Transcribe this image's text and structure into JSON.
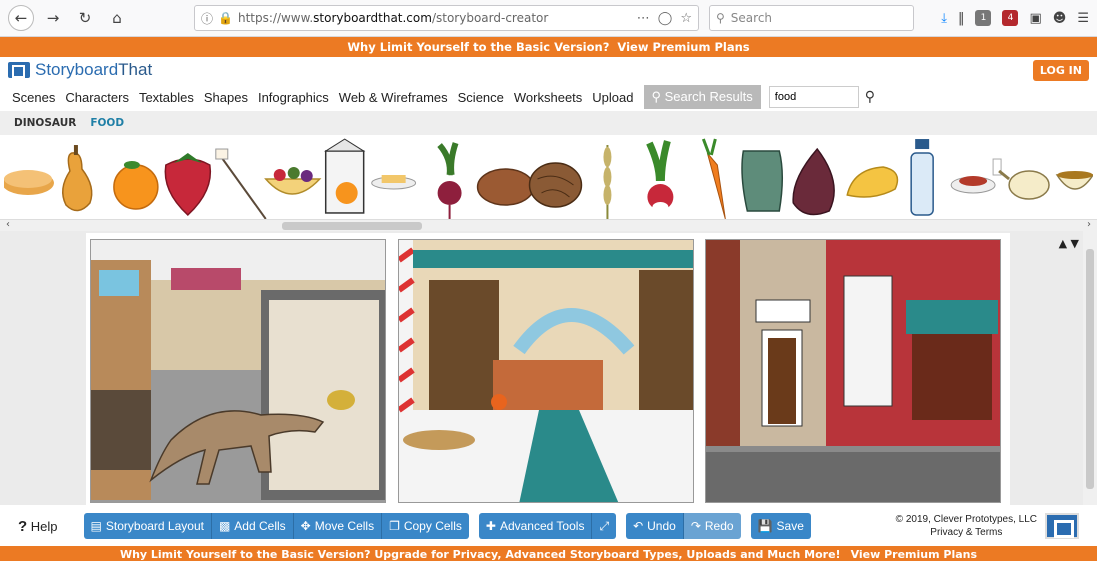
{
  "browser": {
    "url_prefix": "https://www.",
    "url_domain": "storyboardthat.com",
    "url_path": "/storyboard-creator",
    "search_placeholder": "Search",
    "badge_1": "1",
    "badge_4": "4"
  },
  "promo_top": {
    "message": "Why Limit Yourself to the Basic Version?",
    "link": "View Premium Plans"
  },
  "header": {
    "logo_a": "Storyboard",
    "logo_b": "That",
    "login": "LOG IN"
  },
  "categories": {
    "items": [
      "Scenes",
      "Characters",
      "Textables",
      "Shapes",
      "Infographics",
      "Web & Wireframes",
      "Science",
      "Worksheets",
      "Upload"
    ],
    "active": "Search Results",
    "search_value": "food"
  },
  "subtabs": [
    "DINOSAUR",
    "FOOD"
  ],
  "food_icons": [
    "pie-icon",
    "butternut-squash-icon",
    "orange-icon",
    "strawberry-icon",
    "marshmallow-stick-icon",
    "fruit-bowl-icon",
    "juice-carton-icon",
    "flan-icon",
    "beet-icon",
    "potato-icon",
    "walnut-icon",
    "wheat-icon",
    "radish-icon",
    "carrot-icon",
    "pitcher-icon",
    "fig-icon",
    "omelette-icon",
    "water-bottle-icon",
    "spaghetti-plate-icon",
    "teapot-icon",
    "soup-bowl-icon"
  ],
  "toolbar": {
    "help": "Help",
    "storyboard_layout": "Storyboard Layout",
    "add_cells": "Add Cells",
    "move_cells": "Move Cells",
    "copy_cells": "Copy Cells",
    "advanced_tools": "Advanced Tools",
    "undo": "Undo",
    "redo": "Redo",
    "save": "Save",
    "copyright": "© 2019, Clever Prototypes, LLC",
    "privacy": "Privacy & Terms"
  },
  "promo_bottom": {
    "message": "Why Limit Yourself to the Basic Version? Upgrade for Privacy, Advanced Storyboard Types, Uploads and Much More!",
    "link": "View Premium Plans"
  },
  "colors": {
    "accent_orange": "#ec7a23",
    "button_blue": "#3a87c8",
    "brand_blue": "#2b6cb0"
  }
}
